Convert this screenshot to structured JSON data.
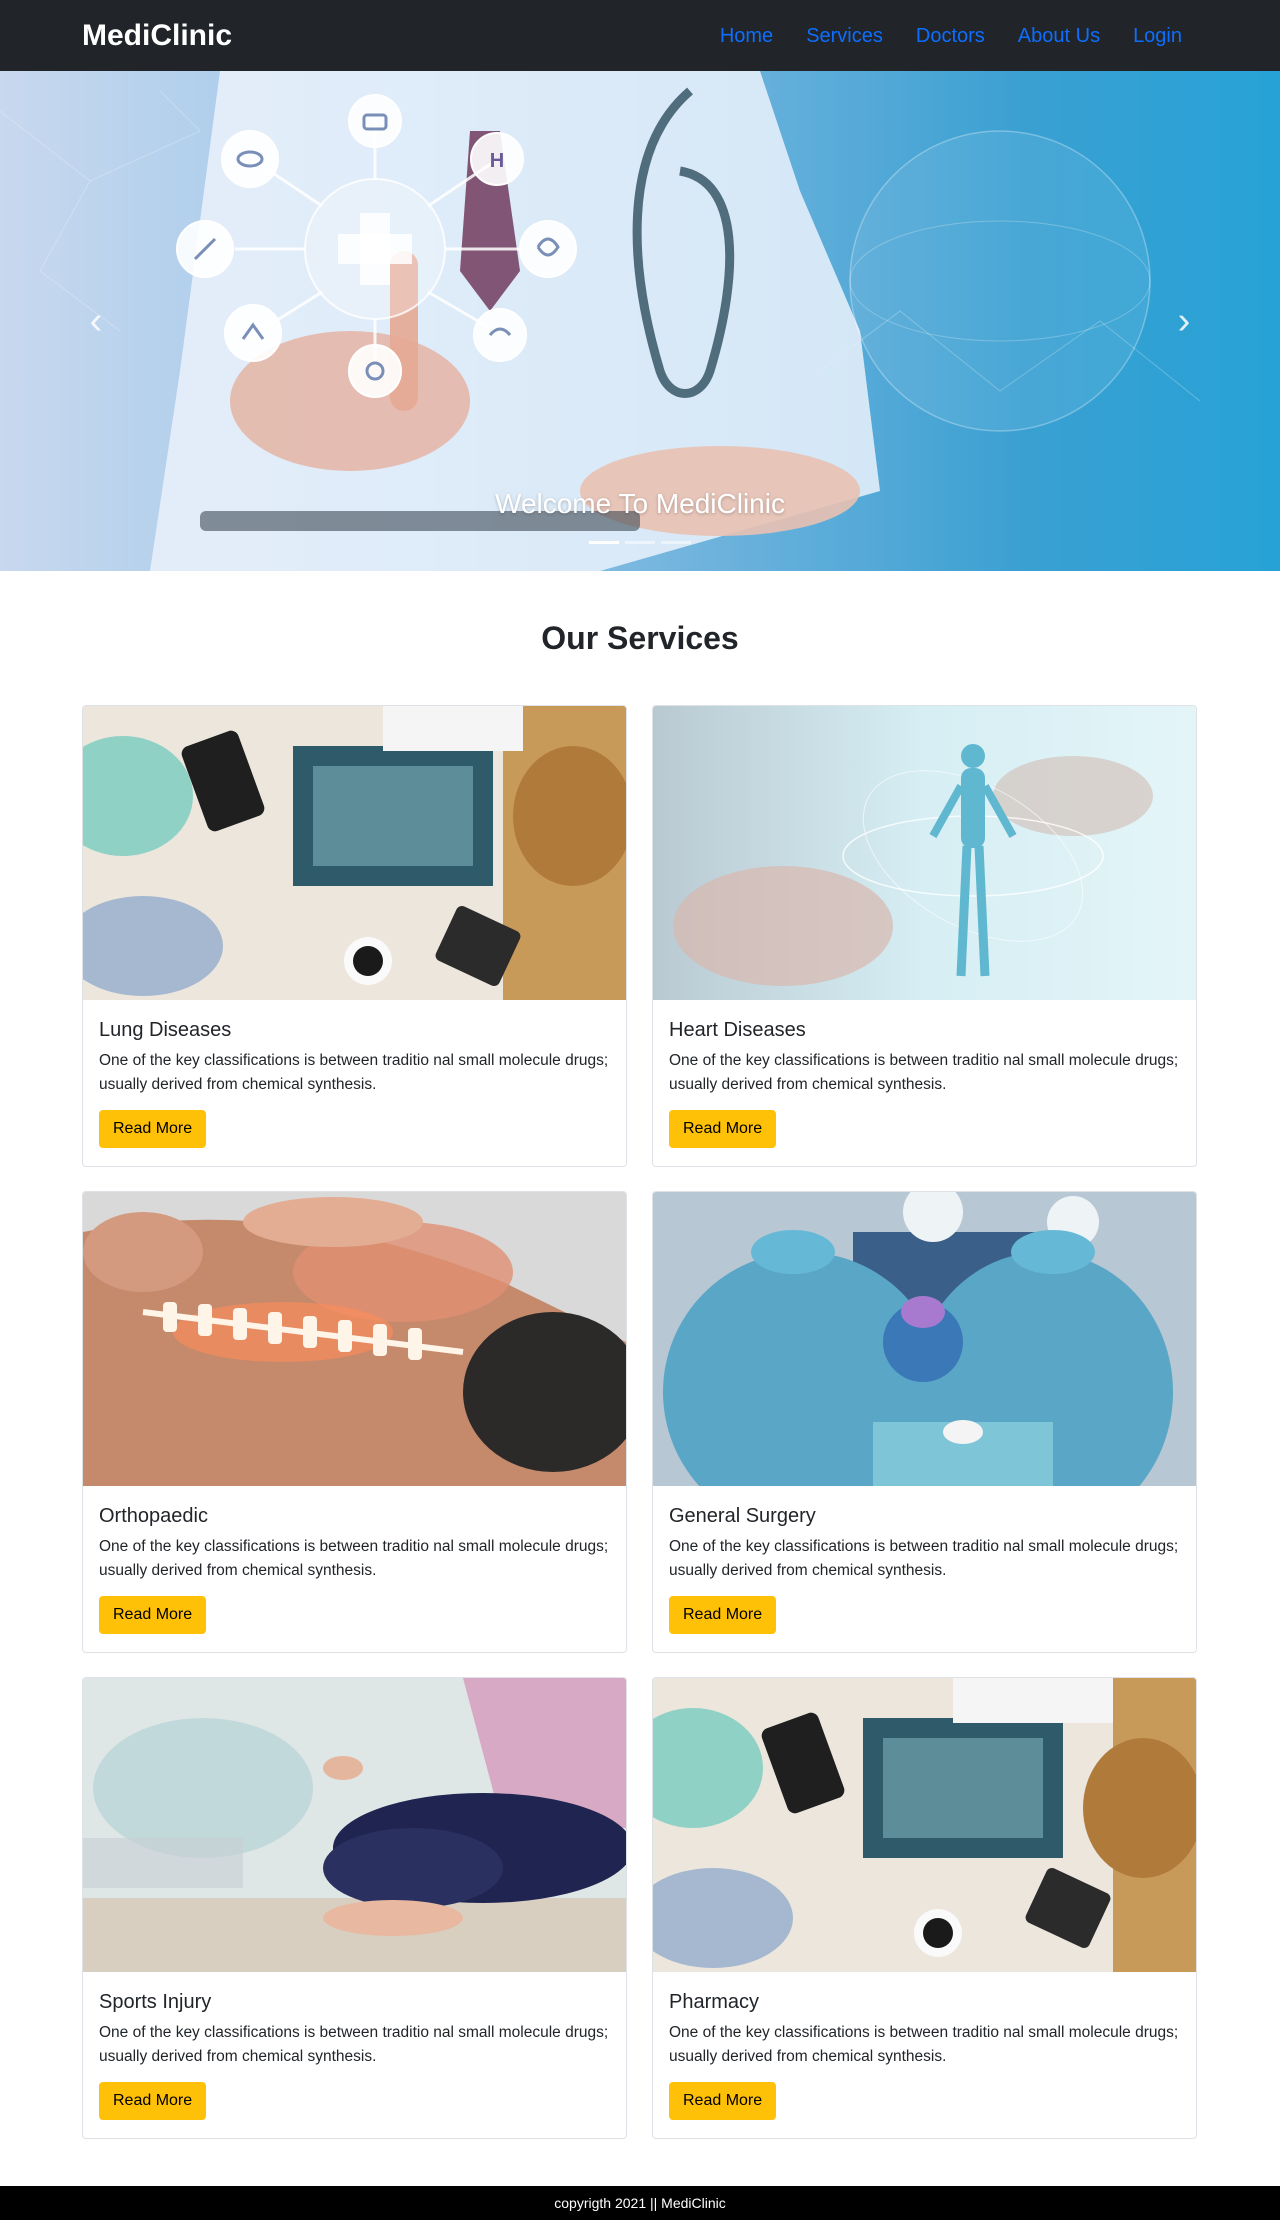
{
  "navbar": {
    "brand": "MediClinic",
    "links": [
      {
        "label": "Home"
      },
      {
        "label": "Services"
      },
      {
        "label": "Doctors"
      },
      {
        "label": "About Us"
      },
      {
        "label": "Login"
      }
    ]
  },
  "hero": {
    "caption": "Welcome To MediClinic",
    "slide_count": 3,
    "active_slide": 1,
    "prev_icon": "chevron-left-icon",
    "next_icon": "chevron-right-icon"
  },
  "services": {
    "title": "Our Services",
    "cards": [
      {
        "title": "Lung Diseases",
        "text": "One of the key classifications is between traditio nal small molecule drugs; usually derived from chemical synthesis.",
        "button": "Read More"
      },
      {
        "title": "Heart Diseases",
        "text": "One of the key classifications is between traditio nal small molecule drugs; usually derived from chemical synthesis.",
        "button": "Read More"
      },
      {
        "title": "Orthopaedic",
        "text": "One of the key classifications is between traditio nal small molecule drugs; usually derived from chemical synthesis.",
        "button": "Read More"
      },
      {
        "title": "General Surgery",
        "text": "One of the key classifications is between traditio nal small molecule drugs; usually derived from chemical synthesis.",
        "button": "Read More"
      },
      {
        "title": "Sports Injury",
        "text": "One of the key classifications is between traditio nal small molecule drugs; usually derived from chemical synthesis.",
        "button": "Read More"
      },
      {
        "title": "Pharmacy",
        "text": "One of the key classifications is between traditio nal small molecule drugs; usually derived from chemical synthesis.",
        "button": "Read More"
      }
    ]
  },
  "footer": {
    "text": "copyrigth 2021 || MediClinic"
  },
  "colors": {
    "navbar_bg": "#212529",
    "nav_link": "#0d6efd",
    "button_bg": "#ffc107",
    "footer_bg": "#000000"
  }
}
